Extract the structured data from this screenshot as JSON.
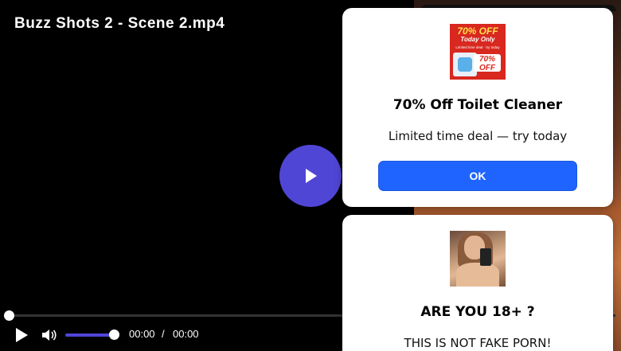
{
  "player": {
    "title": "Buzz Shots 2 - Scene 2.mp4",
    "accent_color": "#5046d6",
    "progress": 0.0,
    "volume": 1.0,
    "time_current": "00:00",
    "time_separator": "/",
    "time_total": "00:00",
    "icons": {
      "big_play": "play-icon",
      "play": "play-icon",
      "volume": "volume-icon"
    }
  },
  "ads": [
    {
      "promo_headline": "70% OFF",
      "promo_subline": "Today Only",
      "promo_deal": "Limited time deal · try today",
      "promo_badge_top": "70%",
      "promo_badge_bottom": "OFF",
      "title": "70% Off Toilet Cleaner",
      "text": "Limited time deal — try today",
      "button_label": "OK",
      "button_color": "#1f64ff"
    },
    {
      "title": "ARE YOU 18+ ?",
      "text": "THIS IS NOT FAKE PORN!"
    }
  ]
}
